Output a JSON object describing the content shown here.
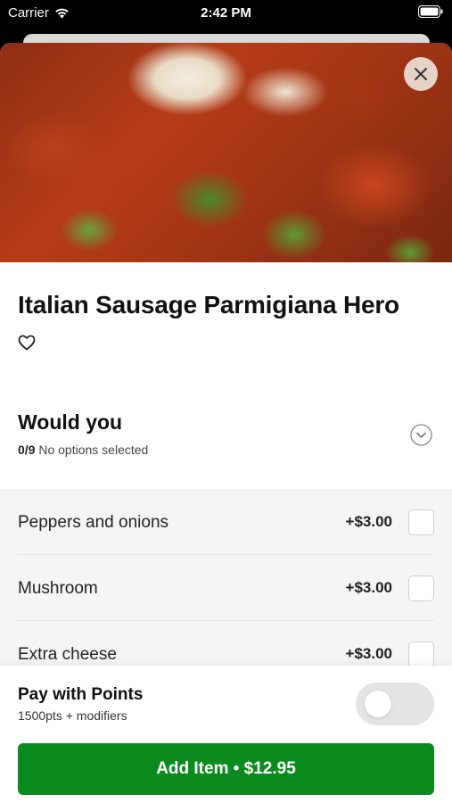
{
  "status_bar": {
    "carrier": "Carrier",
    "time": "2:42 PM",
    "icons": [
      "wifi-icon",
      "battery-icon"
    ]
  },
  "item": {
    "title": "Italian Sausage Parmigiana Hero",
    "favorite_icon": "heart-outline-icon",
    "close_icon": "close-icon"
  },
  "modifier_group": {
    "title": "Would you",
    "selected_count": "0/9",
    "status_text": "No options selected",
    "toggle_icon": "chevron-down-circle-icon",
    "options": [
      {
        "name": "Peppers and onions",
        "price": "+$3.00",
        "checked": false
      },
      {
        "name": "Mushroom",
        "price": "+$3.00",
        "checked": false
      },
      {
        "name": "Extra cheese",
        "price": "+$3.00",
        "checked": false
      }
    ]
  },
  "footer": {
    "points_title": "Pay with Points",
    "points_subtitle": "1500pts + modifiers",
    "points_enabled": false,
    "add_button_label": "Add Item • $12.95"
  },
  "colors": {
    "accent": "#0b8a1e",
    "options_background": "#f5f5f5",
    "toggle_off": "#e3e3e3"
  }
}
